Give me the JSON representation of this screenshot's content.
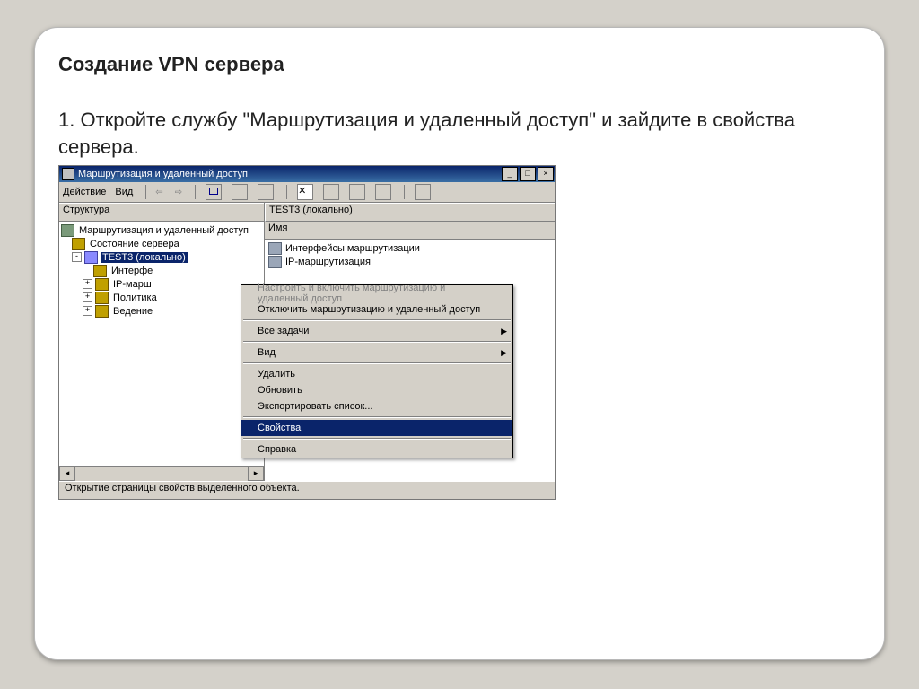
{
  "slide": {
    "title": "Создание VPN сервера",
    "instruction": "1. Откройте службу \"Маршрутизация и удаленный доступ\" и зайдите в свойства сервера."
  },
  "window": {
    "title": "Маршрутизация и удаленный доступ",
    "menu": {
      "action": "Действие",
      "view": "Вид"
    },
    "left_header": "Структура",
    "right_header": "TEST3 (локально)",
    "right_sub": "Имя",
    "tree": {
      "root": "Маршрутизация и удаленный доступ",
      "status": "Состояние сервера",
      "server": "TEST3 (локально)",
      "child1": "Интерфе",
      "child2": "IP-марш",
      "child3": "Политика",
      "child4": "Ведение"
    },
    "list": {
      "row1": "Интерфейсы маршрутизации",
      "row2": "IP-маршрутизация"
    },
    "statusbar": "Открытие страницы свойств выделенного объекта."
  },
  "ctx": {
    "configure": "Настроить и включить маршрутизацию и удаленный доступ",
    "disable": "Отключить маршрутизацию и удаленный доступ",
    "alltasks": "Все задачи",
    "view": "Вид",
    "delete": "Удалить",
    "refresh": "Обновить",
    "export": "Экспортировать список...",
    "properties": "Свойства",
    "help": "Справка"
  }
}
